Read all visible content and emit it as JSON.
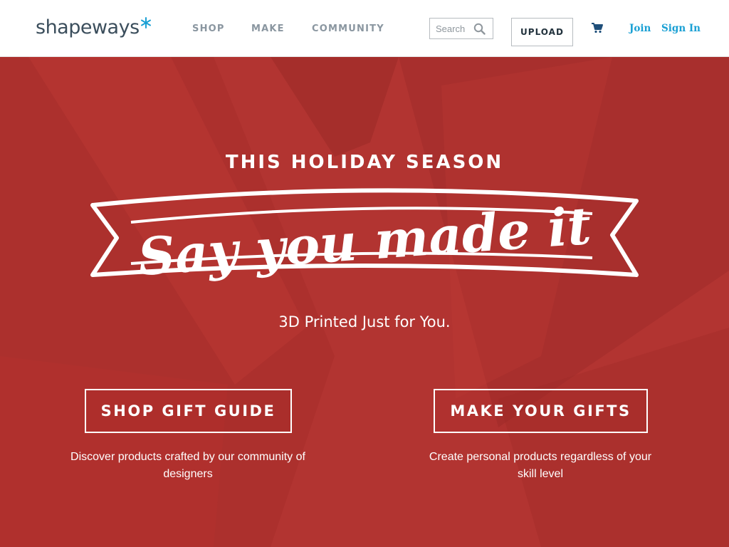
{
  "header": {
    "logo_text": "shapeways",
    "nav": [
      {
        "label": "SHOP"
      },
      {
        "label": "MAKE"
      },
      {
        "label": "COMMUNITY"
      }
    ],
    "search": {
      "placeholder": "Search",
      "value": ""
    },
    "upload_label": "UPLOAD",
    "join_label": "Join",
    "sign_in_label": "Sign In"
  },
  "hero": {
    "eyebrow": "THIS HOLIDAY SEASON",
    "banner_title": "Say you made it",
    "tagline": "3D Printed Just for You.",
    "ctas": [
      {
        "label": "SHOP GIFT GUIDE",
        "description": "Discover products crafted by our community of designers"
      },
      {
        "label": "MAKE YOUR GIFTS",
        "description": "Create personal products regardless of your skill level"
      }
    ]
  },
  "icons": {
    "logo": "star-icon",
    "search": "search-icon",
    "cart": "cart-icon"
  },
  "colors": {
    "hero_red": "#b23431",
    "link_blue": "#1aa0d4",
    "logo_star": "#1aa0d4",
    "logo_text": "#3b4e5c",
    "nav_gray": "#8a96a0"
  }
}
